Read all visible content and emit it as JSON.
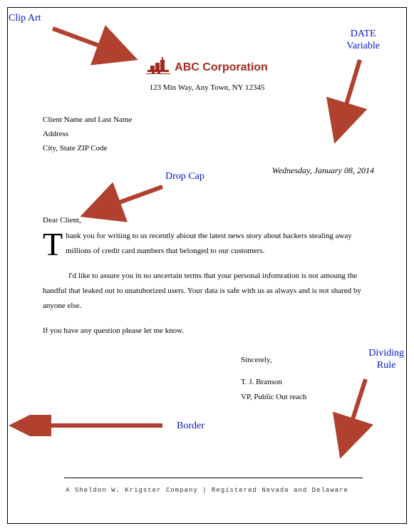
{
  "callouts": {
    "clipart": "Clip Art",
    "date": "DATE\nVariable",
    "dropcap": "Drop Cap",
    "dividing": "Dividing\nRule",
    "border": "Border"
  },
  "letterhead": {
    "company": "ABC Corporation",
    "address": "123 Min Way, Any Town, NY 12345"
  },
  "recipient": {
    "name": "Client Name and Last Name",
    "address": "Address",
    "csz": "City, State ZIP Code"
  },
  "date": "Wednesday, January 08, 2014",
  "salutation": "Dear Client,",
  "body": {
    "dropcap": "T",
    "p1_rest": "hank you for writing to us recently abiout the latest news story about hackers stealing away millions of credit card numbers that belonged to our customers.",
    "p2": "I'd like to assure you in no uncertain terms that your personal infomration is not amoung the handful that leaked out to unatuhorized users. Your data is safe with us as always and is not shared by anyone else.",
    "p3": "If you have any question please let me know."
  },
  "closing": {
    "word": "Sincerely,",
    "name": "T. J. Branson",
    "title": "VP, Public Out reach"
  },
  "footer": "A Sheldon W. Krigster Company | Registered Nevada and Delaware",
  "colors": {
    "brand": "#a32a1f",
    "callout": "#0018c8",
    "arrow": "#b0412e"
  }
}
